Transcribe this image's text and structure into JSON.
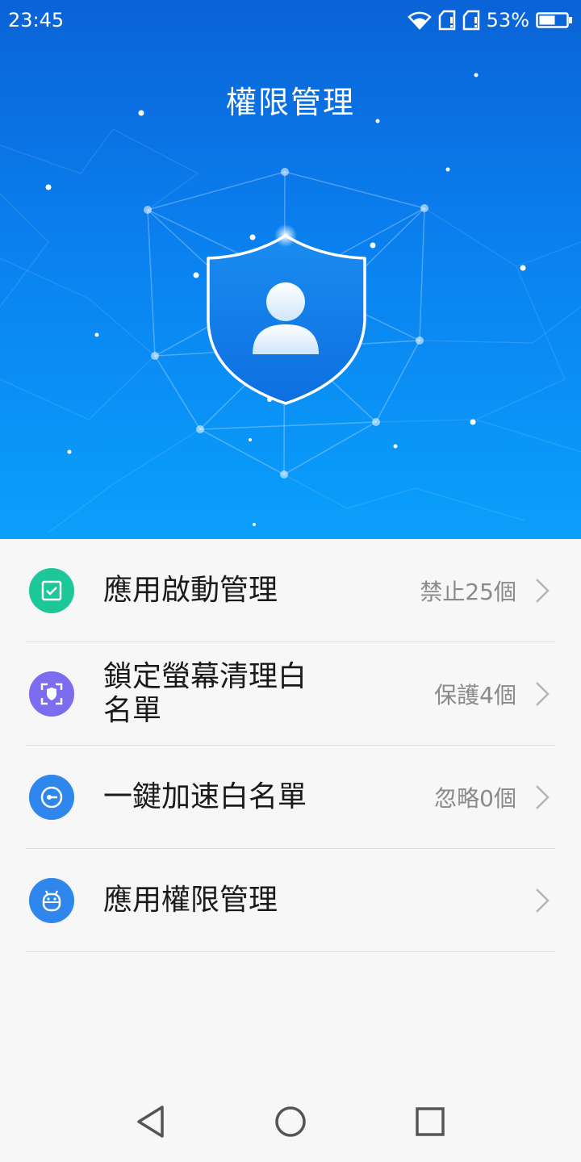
{
  "status": {
    "time": "23:45",
    "battery": "53%"
  },
  "header": {
    "title": "權限管理"
  },
  "items": [
    {
      "label": "應用啟動管理",
      "value": "禁止25個",
      "icon": "app-start-check-icon",
      "color": "#1dc79a"
    },
    {
      "label": "鎖定螢幕清理白名單",
      "value": "保護4個",
      "icon": "lock-screen-shield-icon",
      "color": "#7b6cf0"
    },
    {
      "label": "一鍵加速白名單",
      "value": "忽略0個",
      "icon": "speed-dial-icon",
      "color": "#2f86ec"
    },
    {
      "label": "應用權限管理",
      "value": "",
      "icon": "android-robot-icon",
      "color": "#2f86ec"
    }
  ],
  "nav": {
    "back": "back-triangle-icon",
    "home": "home-circle-icon",
    "recents": "recents-square-icon"
  }
}
